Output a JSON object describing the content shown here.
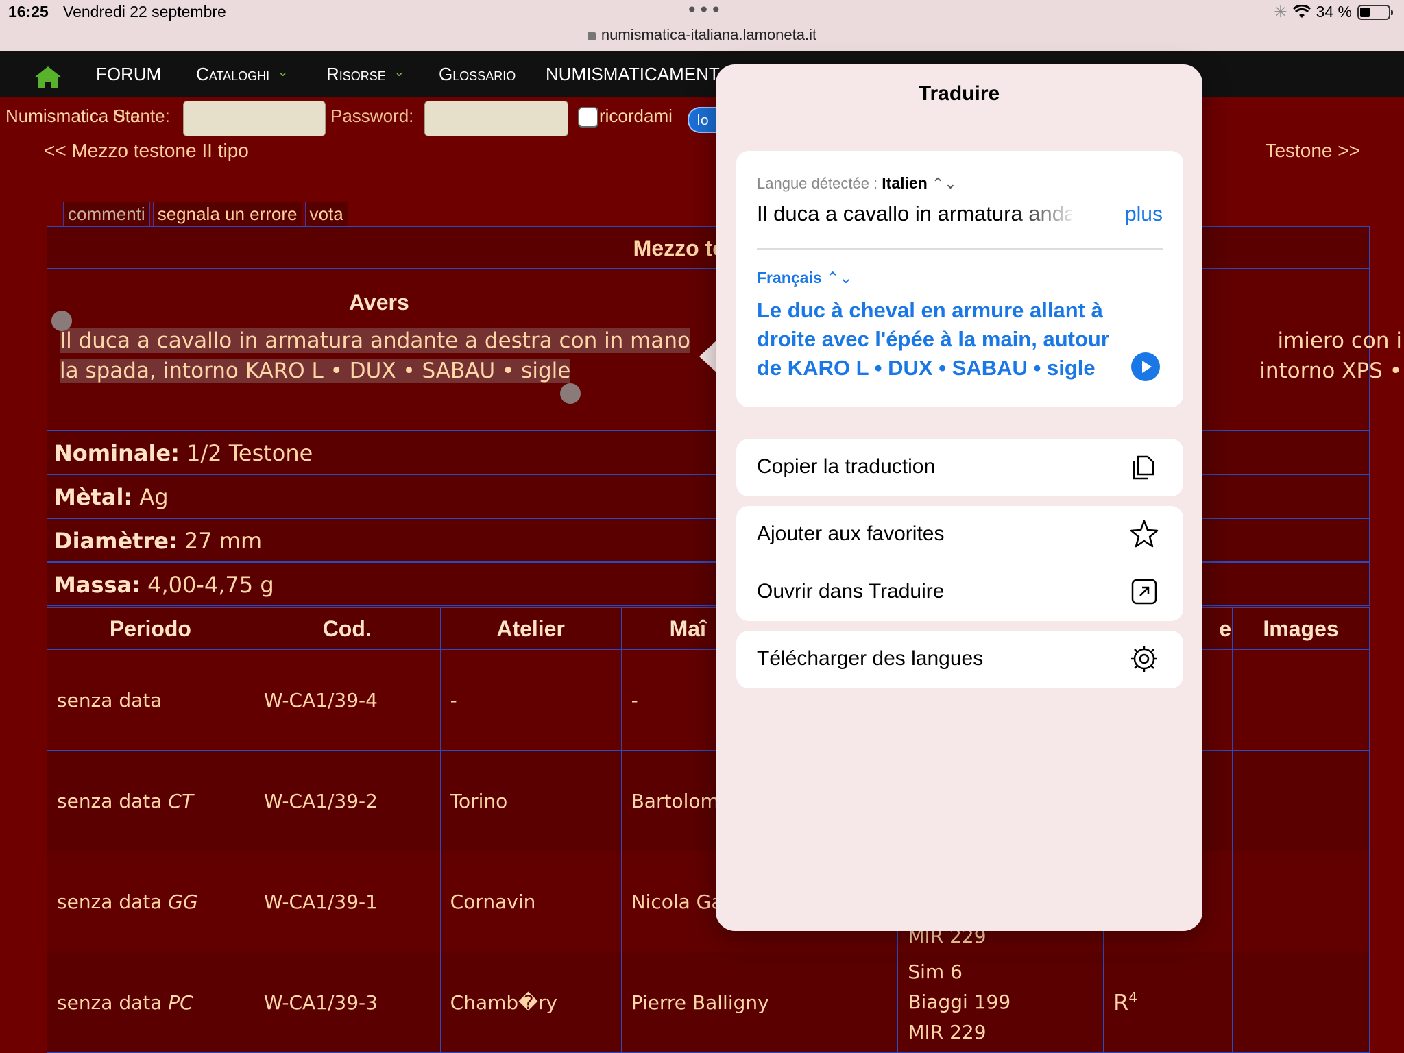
{
  "status": {
    "time": "16:25",
    "date": "Vendredi 22 septembre",
    "battery": "34 %",
    "url": "numismatica-italiana.lamoneta.it"
  },
  "nav": {
    "items": [
      {
        "label": "FORUM",
        "dropdown": false
      },
      {
        "label": "Cataloghi",
        "dropdown": true
      },
      {
        "label": "Risorse",
        "dropdown": true
      },
      {
        "label": "Glossario",
        "dropdown": false
      },
      {
        "label": "NUMISMATICAMENT",
        "dropdown": false
      }
    ]
  },
  "login": {
    "site_prefix": "Numismatica Sta",
    "user_label": "Utente:",
    "password_label": "Password:",
    "remember_label": "ricordami",
    "login_button": "lo"
  },
  "pager": {
    "prev": "<< Mezzo testone II tipo",
    "next": "Testone >>"
  },
  "tabs": [
    "commenti",
    "segnala un errore",
    "vota"
  ],
  "coin": {
    "title": "Mezzo testone",
    "avers_heading": "Avers",
    "avers_text": "Il duca a cavallo in armatura andante a destra con in mano la spada, intorno KARO L • DUX • SABAU • sigle",
    "revers_line1": "imiero  con  i",
    "revers_line2": "intorno XPS •",
    "nominal_label": "Nominale:",
    "nominal": "1/2 Testone",
    "metal_label": "Mètal:",
    "metal": "Ag",
    "diameter_label": "Diamètre:",
    "diameter": "27 mm",
    "mass_label": "Massa:",
    "mass": "4,00-4,75 g"
  },
  "table": {
    "headers": [
      "Periodo",
      "Cod.",
      "Atelier",
      "Maî",
      "",
      "e",
      "Images"
    ],
    "rows": [
      {
        "periodo": "senza data",
        "periodo_suffix": "",
        "cod": "W-CA1/39-4",
        "atelier": "-",
        "maitre": "-",
        "refs": "",
        "rarity": ""
      },
      {
        "periodo": "senza data",
        "periodo_suffix": "CT",
        "cod": "W-CA1/39-2",
        "atelier": "Torino",
        "maitre": "Bartolom",
        "refs": "",
        "rarity": ""
      },
      {
        "periodo": "senza data",
        "periodo_suffix": "GG",
        "cod": "W-CA1/39-1",
        "atelier": "Cornavin",
        "maitre": "Nicola Ga",
        "refs": "MIR 229",
        "rarity": ""
      },
      {
        "periodo": "senza data",
        "periodo_suffix": "PC",
        "cod": "W-CA1/39-3",
        "atelier": "Chamb�ry",
        "maitre": "Pierre Balligny",
        "refs1": "Sim 6",
        "refs2": "Biaggi 199",
        "refs3": "MIR 229",
        "rarity": "R",
        "rarity_sup": "4"
      }
    ]
  },
  "translate": {
    "title": "Traduire",
    "detected_label": "Langue détectée :",
    "detected_lang": "Italien",
    "source_text": "Il duca a cavallo in armatura anda",
    "more": "plus",
    "target_lang": "Français",
    "target_text": "Le duc à cheval en armure allant à droite avec l'épée à la main, autour de KARO L • DUX • SABAU • sigle",
    "actions": {
      "copy": "Copier la traduction",
      "favorite": "Ajouter aux favorites",
      "open": "Ouvrir dans Traduire",
      "download": "Télécharger des langues"
    }
  }
}
